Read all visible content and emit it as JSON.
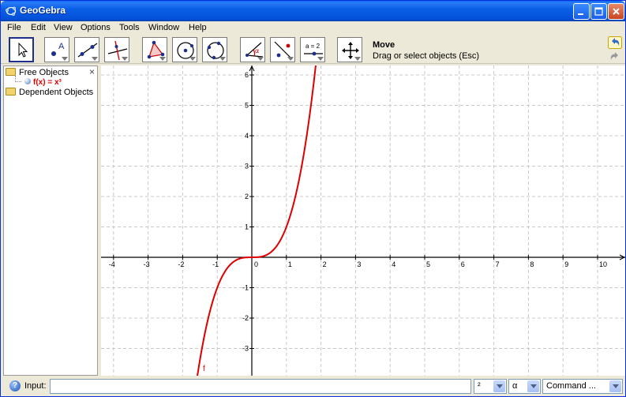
{
  "window": {
    "title": "GeoGebra",
    "controls": [
      "minimize-icon",
      "maximize-icon",
      "close-icon"
    ]
  },
  "menu": [
    "File",
    "Edit",
    "View",
    "Options",
    "Tools",
    "Window",
    "Help"
  ],
  "toolbar": {
    "tools": [
      {
        "icon": "move-arrow-icon",
        "selected": true
      },
      {
        "icon": "new-point-icon",
        "selected": false
      },
      {
        "icon": "line-through-two-points-icon",
        "selected": false
      },
      {
        "icon": "perpendicular-line-icon",
        "selected": false
      },
      {
        "icon": "polygon-icon",
        "selected": false
      },
      {
        "icon": "circle-center-point-icon",
        "selected": false
      },
      {
        "icon": "circle-through-three-points-icon",
        "selected": false
      },
      {
        "icon": "angle-icon",
        "selected": false
      },
      {
        "icon": "reflect-about-line-icon",
        "selected": false
      },
      {
        "icon": "slider-icon",
        "label": "a = 2",
        "selected": false
      },
      {
        "icon": "move-graphics-view-icon",
        "selected": false
      }
    ],
    "active_tool_name": "Move",
    "active_tool_help": "Drag or select objects (Esc)",
    "undo_icon": "undo-icon",
    "redo_icon": "redo-icon"
  },
  "algebra": {
    "free_objects": "Free Objects",
    "dependent_objects": "Dependent Objects",
    "items": [
      {
        "label": "f(x) = x³",
        "color": "#e00000"
      }
    ]
  },
  "graphics": {
    "x_ticks": [
      "-4",
      "-3",
      "-2",
      "-1",
      "0",
      "1",
      "2",
      "3",
      "4",
      "5",
      "6",
      "7",
      "8",
      "9",
      "10"
    ],
    "y_ticks": [
      "6",
      "5",
      "4",
      "3",
      "2",
      "1",
      "-1",
      "-2",
      "-3"
    ],
    "function_label": "f",
    "function_color": "#dd0000",
    "grid": true
  },
  "inputbar": {
    "help_icon": "help-icon",
    "label": "Input:",
    "value": "",
    "symbol_combo": "²",
    "greek_combo": "α",
    "command_combo": "Command ..."
  }
}
